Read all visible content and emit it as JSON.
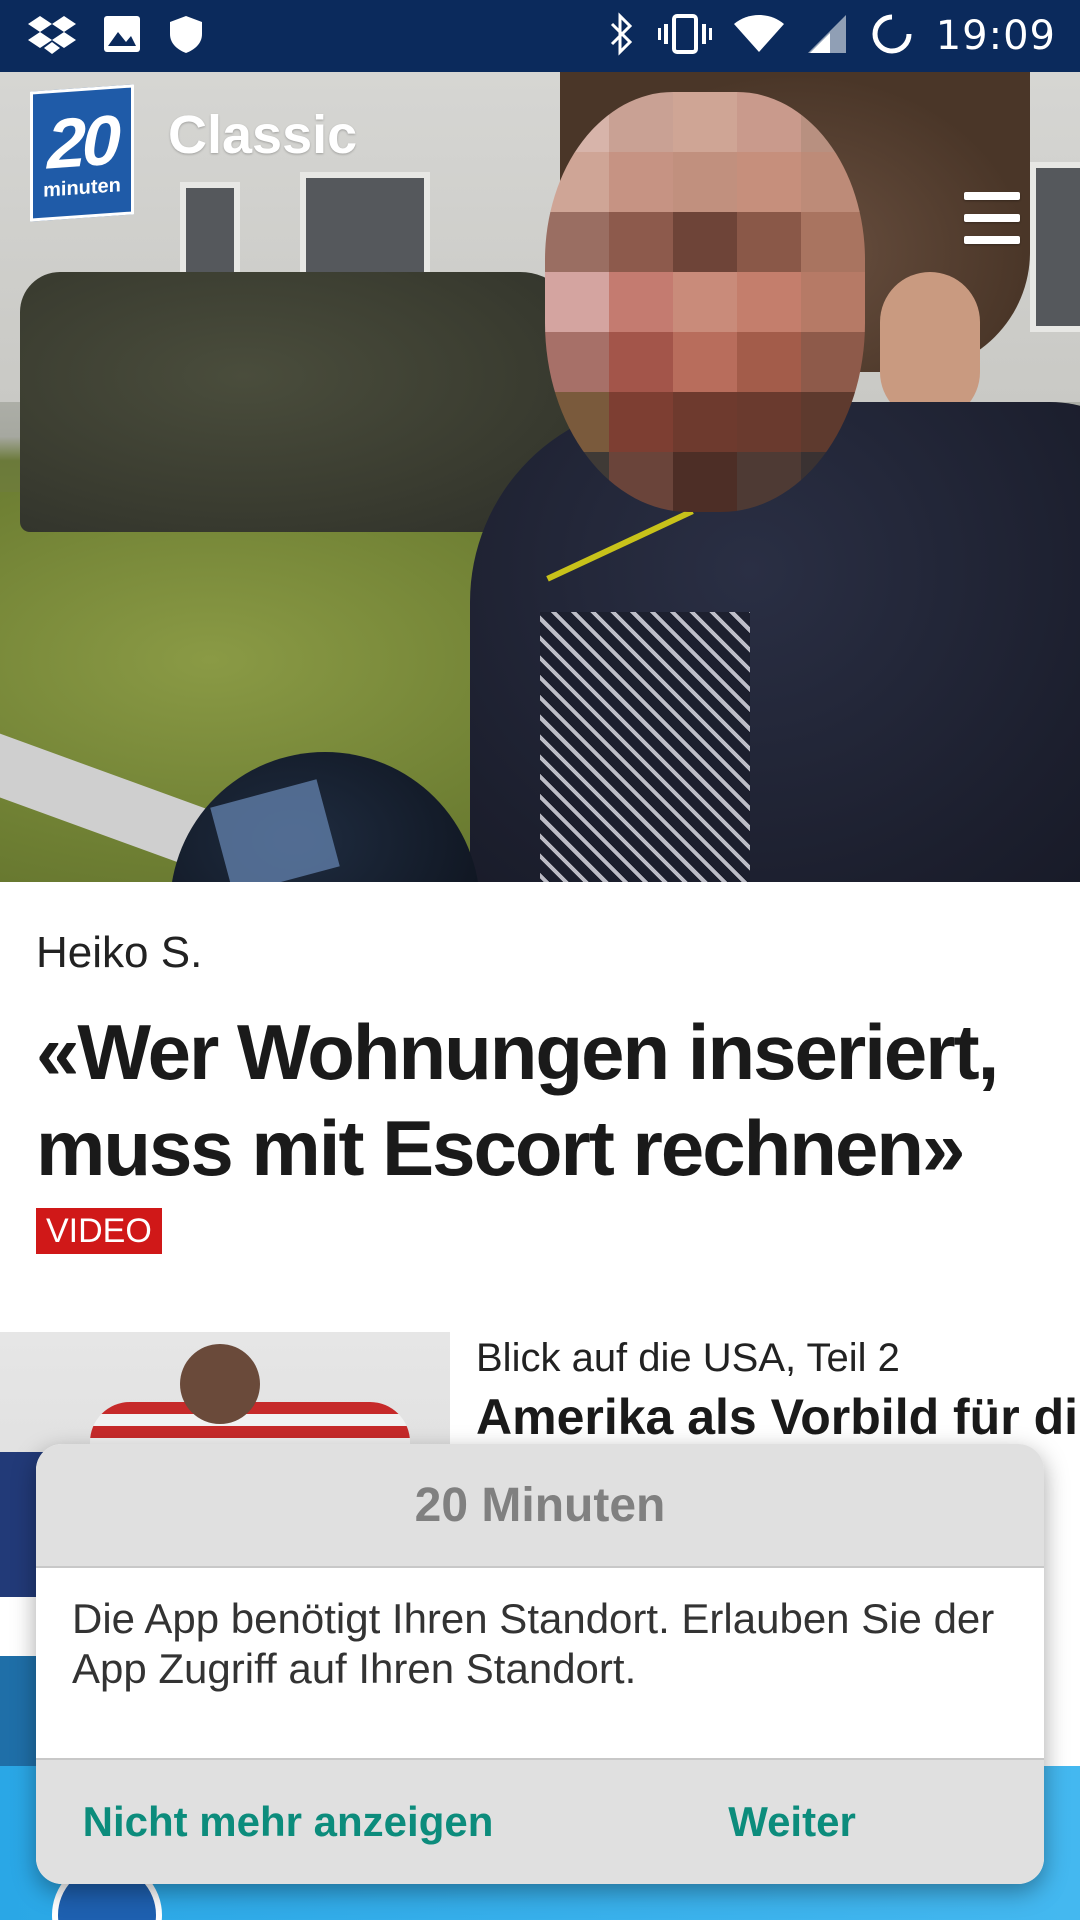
{
  "status_bar": {
    "time": "19:09",
    "left_icons": [
      "dropbox-icon",
      "image-icon",
      "shield-icon"
    ],
    "right_icons": [
      "bluetooth-icon",
      "vibrate-icon",
      "wifi-icon",
      "signal-icon",
      "sync-icon"
    ]
  },
  "header": {
    "logo_number": "20",
    "logo_word": "minuten",
    "title": "Classic",
    "menu_icon": "hamburger-menu-icon"
  },
  "lead_article": {
    "kicker": "Heiko S.",
    "headline": "«Wer Wohnungen inseriert, muss mit Escort rechnen»",
    "badge": "VIDEO"
  },
  "secondary_article": {
    "kicker": "Blick auf die USA, Teil 2",
    "title": "Amerika als Vorbild für die"
  },
  "dialog": {
    "title": "20 Minuten",
    "message": "Die App benötigt Ihren Standort. Erlauben Sie der App Zugriff auf Ihren Standort.",
    "button_dismiss": "Nicht mehr anzeigen",
    "button_continue": "Weiter"
  },
  "colors": {
    "status_bar": "#0b2a5c",
    "badge_red": "#d01818",
    "dialog_action": "#0c8c7c",
    "logo_blue": "#1f5ba8"
  }
}
